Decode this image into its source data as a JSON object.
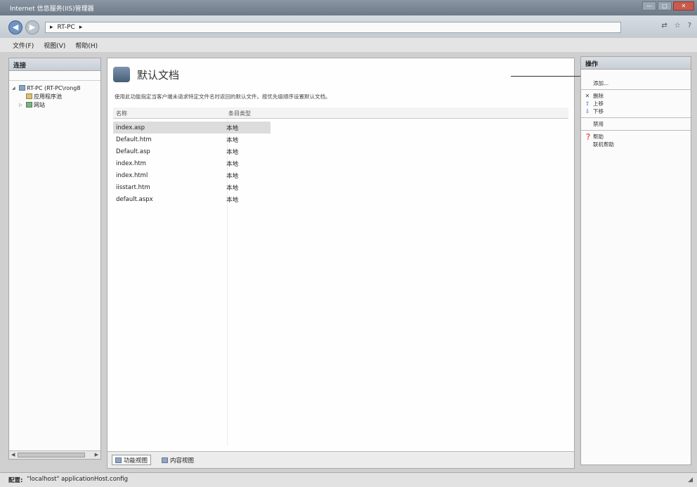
{
  "window": {
    "title": "Internet 信息服务(IIS)管理器",
    "controls": [
      "—",
      "□",
      "✕"
    ]
  },
  "address": {
    "parts": [
      "▸",
      "RT-PC",
      "▸"
    ]
  },
  "topbar_icons": [
    "network-icon",
    "star-icon",
    "help-icon"
  ],
  "menu": [
    "文件(F)",
    "视图(V)",
    "帮助(H)"
  ],
  "left_pane": {
    "header": "连接",
    "toolbar": "",
    "tree": [
      {
        "label": "RT-PC (RT-PC\\rong8",
        "level": 0,
        "expanded": true,
        "icon": "server-icon"
      },
      {
        "label": "应用程序池",
        "level": 1,
        "expanded": false,
        "icon": "app-pool-icon"
      },
      {
        "label": "网站",
        "level": 1,
        "expanded": false,
        "icon": "sites-icon"
      }
    ]
  },
  "center": {
    "title": "默认文档",
    "description": "使用此功能指定当客户端未请求特定文件名时返回的默认文件。按优先级顺序设置默认文档。",
    "columns": [
      "名称",
      "条目类型"
    ],
    "rows": [
      {
        "name": "index.asp",
        "type": "本地",
        "selected": true
      },
      {
        "name": "Default.htm",
        "type": "本地",
        "selected": false
      },
      {
        "name": "Default.asp",
        "type": "本地",
        "selected": false
      },
      {
        "name": "index.htm",
        "type": "本地",
        "selected": false
      },
      {
        "name": "index.html",
        "type": "本地",
        "selected": false
      },
      {
        "name": "iisstart.htm",
        "type": "本地",
        "selected": false
      },
      {
        "name": "default.aspx",
        "type": "本地",
        "selected": false
      }
    ],
    "view_tabs": [
      "功能视图",
      "内容视图"
    ]
  },
  "right_pane": {
    "header": "操作",
    "actions": [
      {
        "label": "添加...",
        "icon": "",
        "enabled": true
      },
      {
        "separator": true
      },
      {
        "label": "删除",
        "icon": "delete-icon",
        "enabled": true
      },
      {
        "label": "上移",
        "icon": "move-up-icon",
        "enabled": true
      },
      {
        "label": "下移",
        "icon": "move-down-icon",
        "enabled": true
      },
      {
        "separator": true
      },
      {
        "label": "禁用",
        "icon": "",
        "enabled": true
      },
      {
        "separator": true
      },
      {
        "label": "帮助",
        "icon": "help-icon",
        "enabled": true
      },
      {
        "label": "联机帮助",
        "icon": "",
        "enabled": true
      }
    ]
  },
  "status": {
    "label": "配置:",
    "value": "\"localhost\" applicationHost.config"
  }
}
